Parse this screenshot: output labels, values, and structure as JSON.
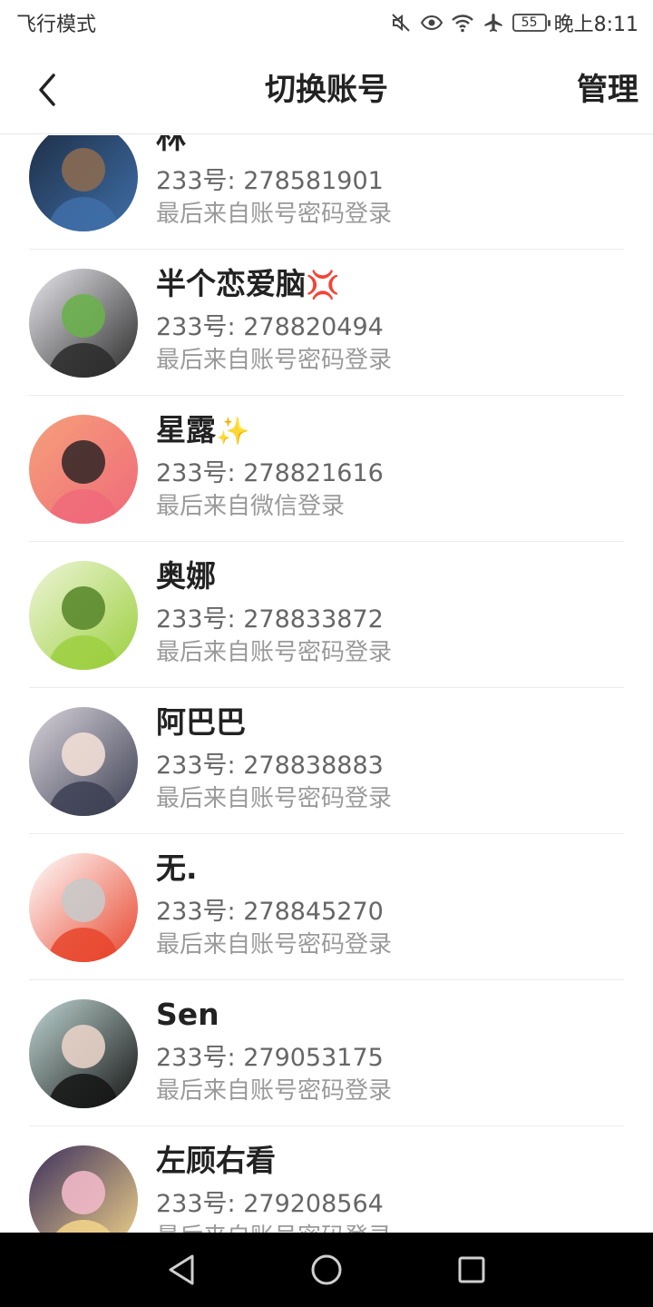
{
  "status_bar": {
    "mode": "飞行模式",
    "battery": "55",
    "time": "晚上8:11",
    "icons": [
      "mute-icon",
      "eye-icon",
      "wifi-icon",
      "airplane-icon",
      "battery-icon"
    ]
  },
  "header": {
    "title": "切换账号",
    "manage_label": "管理",
    "back_icon": "back-arrow-icon"
  },
  "accounts": [
    {
      "name": "林",
      "emoji": "",
      "id_text": "233号: 278581901",
      "source": "最后来自账号密码登录",
      "avatar_colors": [
        "#1d2d44",
        "#3f6fa8",
        "#8a6a52"
      ]
    },
    {
      "name": "半个恋爱脑",
      "emoji": "💢",
      "id_text": "233号: 278820494",
      "source": "最后来自账号密码登录",
      "avatar_colors": [
        "#e9e9ee",
        "#2a2a2a",
        "#6ab04c"
      ]
    },
    {
      "name": "星露",
      "emoji": "✨",
      "id_text": "233号: 278821616",
      "source": "最后来自微信登录",
      "avatar_colors": [
        "#f5a07a",
        "#f06a7a",
        "#3a2a2a"
      ]
    },
    {
      "name": "奥娜",
      "emoji": "",
      "id_text": "233号: 278833872",
      "source": "最后来自账号密码登录",
      "avatar_colors": [
        "#eef5d8",
        "#9ccf3f",
        "#5b8a2e"
      ]
    },
    {
      "name": "阿巴巴",
      "emoji": "",
      "id_text": "233号: 278838883",
      "source": "最后来自账号密码登录",
      "avatar_colors": [
        "#d9d4dc",
        "#3c3f52",
        "#f1ded6"
      ]
    },
    {
      "name": "无.",
      "emoji": "",
      "id_text": "233号: 278845270",
      "source": "最后来自账号密码登录",
      "avatar_colors": [
        "#ffffff",
        "#e8452c",
        "#c9c9c9"
      ]
    },
    {
      "name": "Sen",
      "emoji": "",
      "id_text": "233号: 279053175",
      "source": "最后来自账号密码登录",
      "avatar_colors": [
        "#bfd6d2",
        "#141414",
        "#e7d2c6"
      ]
    },
    {
      "name": "左顾右看",
      "emoji": "",
      "id_text": "233号: 279208564",
      "source": "最后来自账号密码登录",
      "avatar_colors": [
        "#3b2f5e",
        "#f3d58a",
        "#f0b8c8"
      ]
    }
  ],
  "nav_bar": {
    "icons": [
      "back-triangle-icon",
      "home-circle-icon",
      "recents-square-icon"
    ]
  }
}
